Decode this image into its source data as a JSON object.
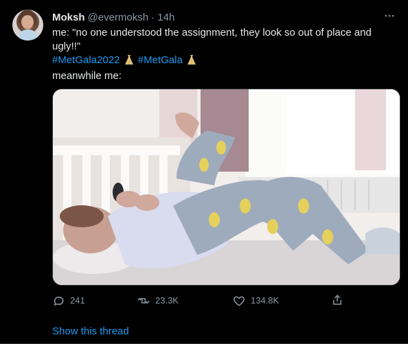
{
  "tweet": {
    "author": {
      "name": "Moksh",
      "handle": "@evermoksh",
      "timestamp": "· 14h"
    },
    "text": {
      "line1": "me: \"no one understood the assignment, they look so out of place and ugly!!\"",
      "hashtag1": "#MetGala2022",
      "hashtag2": "#MetGala",
      "line3": "meanwhile me:"
    },
    "actions": {
      "replies": "241",
      "retweets": "23.3K",
      "likes": "134.8K"
    },
    "show_thread": "Show this thread"
  },
  "colors": {
    "background": "#000000",
    "text": "#e7e9ea",
    "muted": "#8b98a5",
    "accent": "#1d9bf0"
  },
  "icons": {
    "more": "more-horizontal-icon",
    "reply": "reply-icon",
    "retweet": "retweet-icon",
    "like": "heart-icon",
    "share": "share-icon",
    "emoji": "dress-emoji-icon"
  }
}
